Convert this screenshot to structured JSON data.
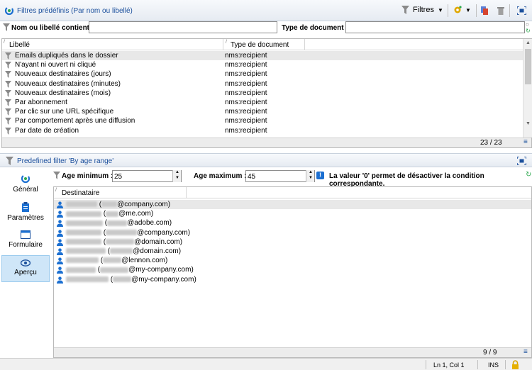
{
  "header": {
    "title": "Filtres prédéfinis (Par nom ou libellé)",
    "filters_label": "Filtres"
  },
  "filterbar": {
    "name_label": "Nom ou libellé contient :",
    "name_value": "",
    "doctype_label": "Type de document :",
    "doctype_value": ""
  },
  "filter_list": {
    "columns": [
      "Libellé",
      "Type de document"
    ],
    "rows": [
      {
        "label": "Emails dupliqués dans le dossier",
        "type": "nms:recipient"
      },
      {
        "label": "N'ayant ni ouvert ni cliqué",
        "type": "nms:recipient"
      },
      {
        "label": "Nouveaux destinataires (jours)",
        "type": "nms:recipient"
      },
      {
        "label": "Nouveaux destinataires (minutes)",
        "type": "nms:recipient"
      },
      {
        "label": "Nouveaux destinataires (mois)",
        "type": "nms:recipient"
      },
      {
        "label": "Par abonnement",
        "type": "nms:recipient"
      },
      {
        "label": "Par clic sur une URL spécifique",
        "type": "nms:recipient"
      },
      {
        "label": "Par comportement après une diffusion",
        "type": "nms:recipient"
      },
      {
        "label": "Par date de création",
        "type": "nms:recipient"
      }
    ],
    "count": "23 / 23"
  },
  "detail": {
    "title": "Predefined filter 'By age range'",
    "nav": [
      {
        "label": "Général",
        "icon": "general-icon"
      },
      {
        "label": "Paramètres",
        "icon": "clipboard-icon"
      },
      {
        "label": "Formulaire",
        "icon": "form-icon"
      },
      {
        "label": "Aperçu",
        "icon": "eye-icon",
        "active": true
      }
    ],
    "age_min_label": "Age minimum :",
    "age_min_value": "25",
    "age_max_label": "Age maximum :",
    "age_max_value": "45",
    "info_text": "La valeur '0' permet de désactiver la condition correspondante.",
    "recipients_header": "Destinataire",
    "recipients": [
      {
        "domain": "@company.com"
      },
      {
        "domain": "@me.com"
      },
      {
        "domain": "@adobe.com"
      },
      {
        "domain": "@company.com"
      },
      {
        "domain": "@domain.com"
      },
      {
        "domain": "@domain.com"
      },
      {
        "domain": "@lennon.com"
      },
      {
        "domain": "@my-company.com"
      },
      {
        "domain": "@my-company.com"
      }
    ],
    "count": "9 / 9"
  },
  "statusbar": {
    "position": "Ln 1, Col 1",
    "mode": "INS"
  },
  "colors": {
    "accent": "#1b4f9c",
    "selected_nav": "#cfe6f8"
  }
}
